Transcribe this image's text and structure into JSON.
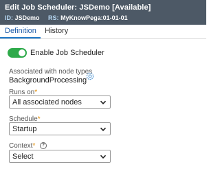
{
  "header": {
    "title": "Edit Job Scheduler: JSDemo [Available]",
    "id_key": "ID:",
    "id_value": "JSDemo",
    "rs_key": "RS:",
    "rs_value": "MyKnowPega:01-01-01",
    "background_color": "#4d5966"
  },
  "tabs": [
    {
      "label": "Definition",
      "active": true
    },
    {
      "label": "History",
      "active": false
    }
  ],
  "toggle": {
    "label": "Enable Job Scheduler",
    "checked": true,
    "color": "#2eaa4a"
  },
  "node_types": {
    "label": "Associated with node types",
    "value": "BackgroundProcessing",
    "icon": "gear-icon"
  },
  "runs_on": {
    "label": "Runs on",
    "required_marker": "*",
    "selected": "All associated nodes"
  },
  "schedule": {
    "label": "Schedule",
    "required_marker": "*",
    "selected": "Startup"
  },
  "context": {
    "label": "Context",
    "required_marker": "*",
    "selected": "Select",
    "help_icon": "?"
  },
  "colors": {
    "accent": "#1f78c8",
    "required": "#e08a00"
  }
}
